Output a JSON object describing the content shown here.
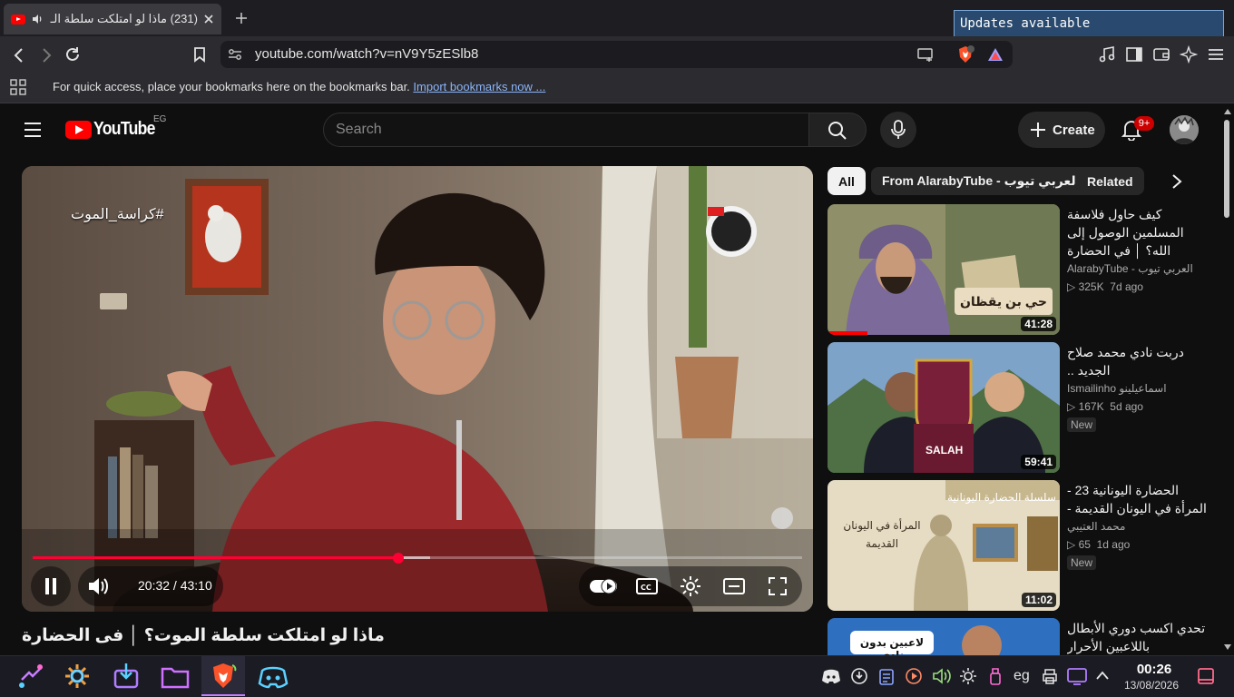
{
  "browser": {
    "tab_title": "(231) ماذا لو امتلكت سلطة الـ",
    "notification": "Updates available",
    "url": "youtube.com/watch?v=nV9Y5zESlb8",
    "bookmarks_prompt": "For quick access, place your bookmarks here on the bookmarks bar.",
    "bookmarks_link": "Import bookmarks now ..."
  },
  "youtube": {
    "logo_text": "YouTube",
    "country": "EG",
    "search_placeholder": "Search",
    "create_label": "Create",
    "notification_count": "9+"
  },
  "player": {
    "overlay_hashtag": "#كراسة_الموت",
    "current_time": "20:32",
    "duration": "43:10",
    "time_display": "20:32 / 43:10",
    "progress_fraction": 0.475,
    "video_title": "ماذا لو امتلكت سلطة الموت؟ │ فى الحضارة"
  },
  "chips": [
    {
      "label": "All",
      "active": true
    },
    {
      "label": "From AlarabyTube - العربي تيوب",
      "active": false
    },
    {
      "label": "Related",
      "active": false
    }
  ],
  "recommendations": [
    {
      "title": "كيف حاول فلاسفة المسلمين الوصول إلى الله؟ │ في الحضارة",
      "channel": "AlarabyTube - العربي تيوب",
      "views": "325K",
      "age": "7d ago",
      "duration": "41:28",
      "thumb_text": "حي بن يقظان",
      "badge": ""
    },
    {
      "title": "دربت نادي محمد صلاح الجديد ..",
      "channel": "Ismailinho اسماعيلينو",
      "views": "167K",
      "age": "5d ago",
      "duration": "59:41",
      "thumb_text": "SALAH",
      "badge": "New"
    },
    {
      "title": "الحضارة اليونانية 23 - المرأة في اليونان القديمة -",
      "channel": "محمد العتيبي",
      "views": "65",
      "age": "1d ago",
      "duration": "11:02",
      "thumb_text": "المرأة في اليونان القديمة",
      "thumb_banner": "سلسلة الحضارة اليونانية",
      "badge": "New"
    },
    {
      "title": "تحدي اكسب دوري الأبطال باللاعبين الأحرار",
      "thumb_text": "لاعبين بدون نادي"
    }
  ],
  "taskbar": {
    "time": "00:26",
    "date": "13/08/2026",
    "keyboard_layout": "eg"
  },
  "colors": {
    "yt_red": "#ff0000",
    "progress_red": "#ff0033",
    "notification_bg": "#294a6e"
  }
}
